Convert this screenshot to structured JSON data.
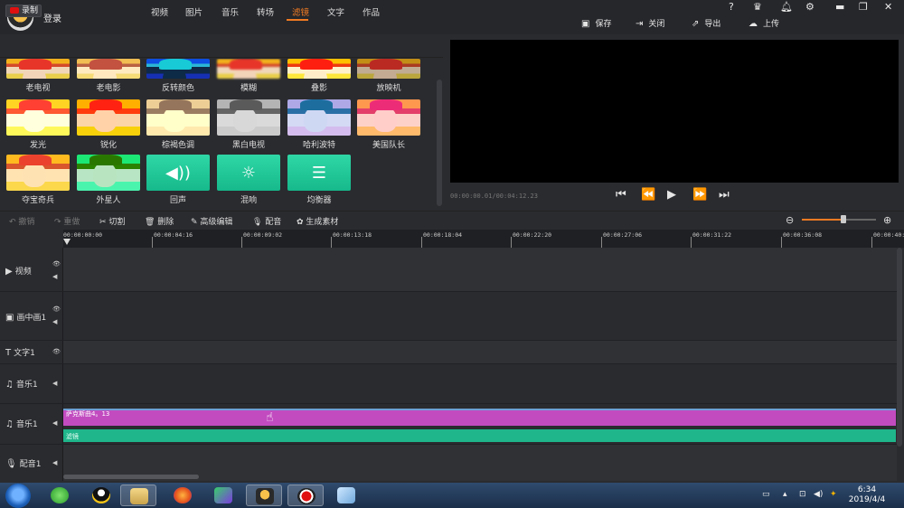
{
  "titlebar": {
    "login": "登录",
    "icons": [
      "help-icon",
      "skin-icon",
      "bell-icon",
      "gear-icon",
      "minimize-icon",
      "restore-icon",
      "close-icon"
    ],
    "help_glyph": "?",
    "actions": [
      {
        "label": "保存",
        "icon": "save-icon"
      },
      {
        "label": "关闭",
        "icon": "exit-icon"
      },
      {
        "label": "导出",
        "icon": "export-icon"
      },
      {
        "label": "上传",
        "icon": "upload-icon"
      }
    ]
  },
  "media": {
    "record_label": "录制",
    "tabs": [
      "视频",
      "图片",
      "音乐",
      "转场",
      "滤镜",
      "文字",
      "作品"
    ],
    "active_tab": "滤镜"
  },
  "effects": {
    "row1": [
      "老电视",
      "老电影",
      "反转颜色",
      "模糊",
      "叠影",
      "放映机"
    ],
    "row2": [
      "发光",
      "锐化",
      "棕褐色调",
      "黑白电视",
      "哈利波特",
      "美国队长"
    ],
    "row3": [
      "夺宝奇兵",
      "外星人",
      "回声",
      "混响",
      "均衡器"
    ]
  },
  "preview": {
    "timecode": "00:00:00.01/00:04:12.23",
    "buttons": [
      "skip-start-icon",
      "prev-frame-icon",
      "play-icon",
      "next-frame-icon",
      "skip-end-icon"
    ]
  },
  "edit_toolbar": {
    "undo": "撤销",
    "redo": "重做",
    "cut": "切割",
    "delete": "删除",
    "advanced": "高级编辑",
    "dub": "配音",
    "generate": "生成素材",
    "zoom_level": 0.56
  },
  "ruler": [
    "00:00:00:00",
    "00:00:04:16",
    "00:00:09:02",
    "00:00:13:18",
    "00:00:18:04",
    "00:00:22:20",
    "00:00:27:06",
    "00:00:31:22",
    "00:00:36:08",
    "00:00:40:"
  ],
  "tracks": [
    {
      "label": "视频",
      "icon": "video-icon"
    },
    {
      "label": "画中画1",
      "icon": "pip-icon"
    },
    {
      "label": "文字1",
      "icon": "text-icon"
    },
    {
      "label": "音乐1",
      "icon": "music-icon"
    },
    {
      "label": "音乐1",
      "icon": "music-icon"
    },
    {
      "label": "配音1",
      "icon": "mic-icon"
    }
  ],
  "clips": {
    "music_clip": "萨克斯曲4。13",
    "filter_clip": "滤镜"
  },
  "taskbar": {
    "time": "6:34",
    "date": "2019/4/4"
  }
}
